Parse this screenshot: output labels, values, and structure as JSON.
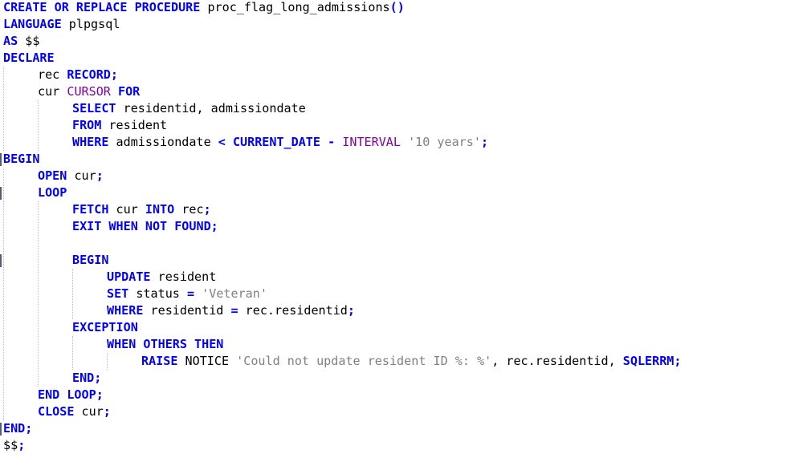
{
  "editor": {
    "colors": {
      "background": "#ffffff",
      "keyword": "#0000ff",
      "builtin": "#8000a0",
      "string": "#808080",
      "identifier": "#000000",
      "indent_guide": "#b8b8b8"
    },
    "lines": [
      {
        "indent": 0,
        "tokens": [
          {
            "t": "CREATE OR REPLACE PROCEDURE",
            "k": "kw"
          },
          {
            "t": " proc_flag_long_admissions",
            "k": "id"
          },
          {
            "t": "()",
            "k": "op"
          }
        ]
      },
      {
        "indent": 0,
        "tokens": [
          {
            "t": "LANGUAGE",
            "k": "kw"
          },
          {
            "t": " plpgsql",
            "k": "id"
          }
        ]
      },
      {
        "indent": 0,
        "tokens": [
          {
            "t": "AS",
            "k": "kw"
          },
          {
            "t": " $$",
            "k": "id"
          }
        ]
      },
      {
        "indent": 0,
        "tokens": [
          {
            "t": "DECLARE",
            "k": "kw"
          }
        ]
      },
      {
        "indent": 1,
        "tokens": [
          {
            "t": "rec ",
            "k": "id"
          },
          {
            "t": "RECORD",
            "k": "kw"
          },
          {
            "t": ";",
            "k": "op"
          }
        ]
      },
      {
        "indent": 1,
        "tokens": [
          {
            "t": "cur ",
            "k": "id"
          },
          {
            "t": "CURSOR",
            "k": "fn"
          },
          {
            "t": " ",
            "k": "id"
          },
          {
            "t": "FOR",
            "k": "kw"
          }
        ]
      },
      {
        "indent": 2,
        "tokens": [
          {
            "t": "SELECT",
            "k": "kw"
          },
          {
            "t": " residentid, admissiondate",
            "k": "id"
          }
        ]
      },
      {
        "indent": 2,
        "tokens": [
          {
            "t": "FROM",
            "k": "kw"
          },
          {
            "t": " resident",
            "k": "id"
          }
        ]
      },
      {
        "indent": 2,
        "tokens": [
          {
            "t": "WHERE",
            "k": "kw"
          },
          {
            "t": " admissiondate ",
            "k": "id"
          },
          {
            "t": "<",
            "k": "op"
          },
          {
            "t": " ",
            "k": "id"
          },
          {
            "t": "CURRENT_DATE",
            "k": "kw"
          },
          {
            "t": " ",
            "k": "id"
          },
          {
            "t": "-",
            "k": "op"
          },
          {
            "t": " ",
            "k": "id"
          },
          {
            "t": "INTERVAL",
            "k": "fn"
          },
          {
            "t": " ",
            "k": "id"
          },
          {
            "t": "'10 years'",
            "k": "str"
          },
          {
            "t": ";",
            "k": "op"
          }
        ]
      },
      {
        "indent": 0,
        "tokens": [
          {
            "t": "BEGIN",
            "k": "kw"
          }
        ]
      },
      {
        "indent": 1,
        "tokens": [
          {
            "t": "OPEN",
            "k": "kw"
          },
          {
            "t": " cur",
            "k": "id"
          },
          {
            "t": ";",
            "k": "op"
          }
        ]
      },
      {
        "indent": 1,
        "tokens": [
          {
            "t": "LOOP",
            "k": "kw"
          }
        ]
      },
      {
        "indent": 2,
        "tokens": [
          {
            "t": "FETCH",
            "k": "kw"
          },
          {
            "t": " cur ",
            "k": "id"
          },
          {
            "t": "INTO",
            "k": "kw"
          },
          {
            "t": " rec",
            "k": "id"
          },
          {
            "t": ";",
            "k": "op"
          }
        ]
      },
      {
        "indent": 2,
        "tokens": [
          {
            "t": "EXIT WHEN NOT FOUND",
            "k": "kw"
          },
          {
            "t": ";",
            "k": "op"
          }
        ]
      },
      {
        "indent": 0,
        "tokens": []
      },
      {
        "indent": 2,
        "tokens": [
          {
            "t": "BEGIN",
            "k": "kw"
          }
        ]
      },
      {
        "indent": 3,
        "tokens": [
          {
            "t": "UPDATE",
            "k": "kw"
          },
          {
            "t": " resident",
            "k": "id"
          }
        ]
      },
      {
        "indent": 3,
        "tokens": [
          {
            "t": "SET",
            "k": "kw"
          },
          {
            "t": " status ",
            "k": "id"
          },
          {
            "t": "=",
            "k": "op"
          },
          {
            "t": " ",
            "k": "id"
          },
          {
            "t": "'Veteran'",
            "k": "str"
          }
        ]
      },
      {
        "indent": 3,
        "tokens": [
          {
            "t": "WHERE",
            "k": "kw"
          },
          {
            "t": " residentid ",
            "k": "id"
          },
          {
            "t": "=",
            "k": "op"
          },
          {
            "t": " rec.residentid",
            "k": "id"
          },
          {
            "t": ";",
            "k": "op"
          }
        ]
      },
      {
        "indent": 2,
        "tokens": [
          {
            "t": "EXCEPTION",
            "k": "kw"
          }
        ]
      },
      {
        "indent": 3,
        "tokens": [
          {
            "t": "WHEN OTHERS THEN",
            "k": "kw"
          }
        ]
      },
      {
        "indent": 4,
        "tokens": [
          {
            "t": "RAISE",
            "k": "kw"
          },
          {
            "t": " NOTICE ",
            "k": "id"
          },
          {
            "t": "'Could not update resident ID %: %'",
            "k": "str"
          },
          {
            "t": ", rec.residentid, ",
            "k": "id"
          },
          {
            "t": "SQLERRM",
            "k": "kw"
          },
          {
            "t": ";",
            "k": "op"
          }
        ]
      },
      {
        "indent": 2,
        "tokens": [
          {
            "t": "END",
            "k": "kw"
          },
          {
            "t": ";",
            "k": "op"
          }
        ]
      },
      {
        "indent": 1,
        "tokens": [
          {
            "t": "END LOOP",
            "k": "kw"
          },
          {
            "t": ";",
            "k": "op"
          }
        ]
      },
      {
        "indent": 1,
        "tokens": [
          {
            "t": "CLOSE",
            "k": "kw"
          },
          {
            "t": " cur",
            "k": "id"
          },
          {
            "t": ";",
            "k": "op"
          }
        ]
      },
      {
        "indent": 0,
        "tokens": [
          {
            "t": "END",
            "k": "kw"
          },
          {
            "t": ";",
            "k": "op"
          }
        ]
      },
      {
        "indent": 0,
        "tokens": [
          {
            "t": "$$",
            "k": "id"
          },
          {
            "t": ";",
            "k": "op"
          }
        ]
      }
    ]
  }
}
